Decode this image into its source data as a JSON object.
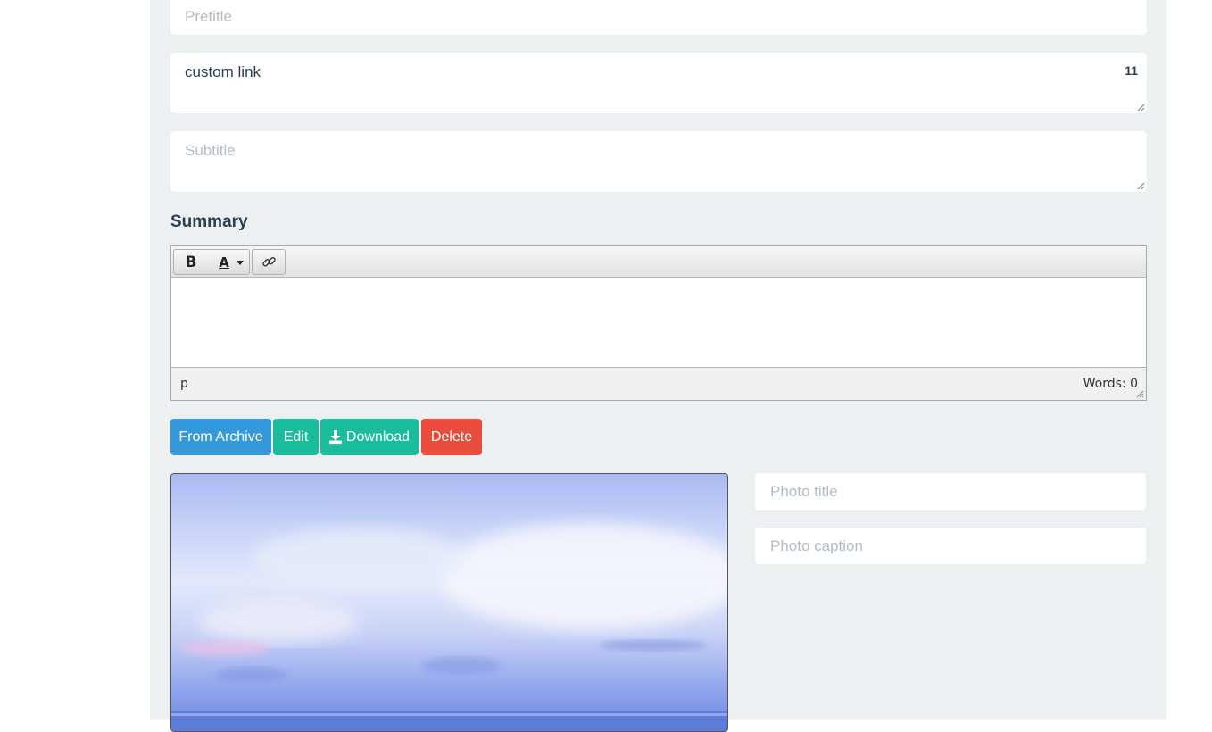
{
  "form": {
    "pretitle_placeholder": "Pretitle",
    "custom_link_value": "custom link",
    "custom_link_counter": "11",
    "subtitle_placeholder": "Subtitle"
  },
  "summary": {
    "label": "Summary",
    "toolbar": {
      "bold_label": "B",
      "text_color_label": "A",
      "icons": [
        "bold-icon",
        "text-color-icon",
        "dropdown-caret-icon",
        "link-icon"
      ]
    },
    "status_path": "p",
    "word_count": "Words: 0"
  },
  "actions": {
    "from_archive_label": "From Archive",
    "edit_label": "Edit",
    "download_label": "Download",
    "delete_label": "Delete",
    "icons": [
      "download-icon"
    ]
  },
  "photo": {
    "title_placeholder": "Photo title",
    "caption_placeholder": "Photo caption"
  },
  "colors": {
    "primary": "#3498db",
    "success": "#1abc9c",
    "danger": "#e74c3c",
    "text": "#2c3e50",
    "panel": "#ecf0f1"
  }
}
